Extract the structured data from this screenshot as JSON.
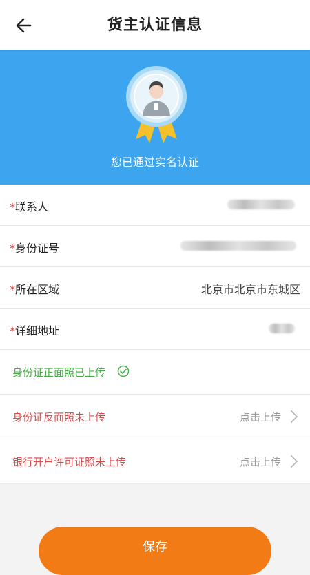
{
  "header": {
    "title": "货主认证信息",
    "back_icon": "back-arrow-icon"
  },
  "hero": {
    "status_text": "您已通过实名认证",
    "bg_color": "#3da5f0",
    "badge_icon": "verified-badge-icon"
  },
  "form": {
    "contact": {
      "label": "联系人",
      "required_mark": "*"
    },
    "id_number": {
      "label": "身份证号",
      "required_mark": "*"
    },
    "region": {
      "label": "所在区域",
      "required_mark": "*",
      "value": "北京市北京市东城区"
    },
    "address": {
      "label": "详细地址",
      "required_mark": "*"
    }
  },
  "uploads": {
    "id_front": {
      "label": "身份证正面照已上传",
      "status_color": "#3fae3f",
      "icon": "check-circle-icon"
    },
    "id_back": {
      "label": "身份证反面照未上传",
      "action": "点击上传",
      "status_color": "#d94a4a"
    },
    "bank_license": {
      "label": "银行开户许可证照未上传",
      "action": "点击上传",
      "status_color": "#d94a4a"
    }
  },
  "footer": {
    "save_label": "保存",
    "button_color": "#f37b15"
  }
}
